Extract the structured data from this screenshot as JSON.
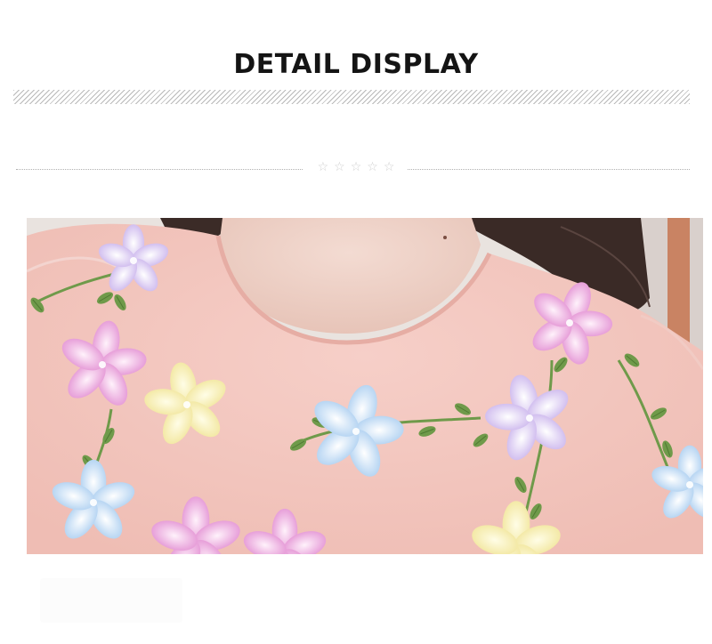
{
  "header": {
    "title": "DETAIL DISPLAY"
  },
  "divider": {
    "stars": [
      "☆",
      "☆",
      "☆",
      "☆",
      "☆"
    ]
  },
  "photo": {
    "subject": "pink-dress-with-3d-flowers",
    "colors": {
      "dress": "#f3c7c0",
      "hair": "#3a2a26",
      "skin": "#efd2c8",
      "leaf": "#6f9a4a",
      "flower_pink": "#e79ad6",
      "flower_blue": "#bcd6ef",
      "flower_yellow": "#f4ecb0",
      "flower_lilac": "#d7c4ee"
    }
  }
}
